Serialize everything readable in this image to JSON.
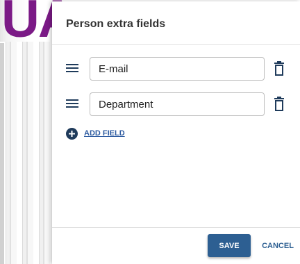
{
  "background": {
    "logo_text": "UA"
  },
  "dialog": {
    "title": "Person extra fields",
    "fields": [
      {
        "value": "E-mail"
      },
      {
        "value": "Department"
      }
    ],
    "add_field_label": "ADD FIELD",
    "save_label": "SAVE",
    "cancel_label": "CANCEL"
  },
  "colors": {
    "primary": "#2d5f92",
    "logo": "#7b1a86",
    "link": "#2c5aa0"
  },
  "icons": {
    "drag": "drag-handle-icon",
    "delete": "trash-icon",
    "add": "plus-circle-icon"
  }
}
